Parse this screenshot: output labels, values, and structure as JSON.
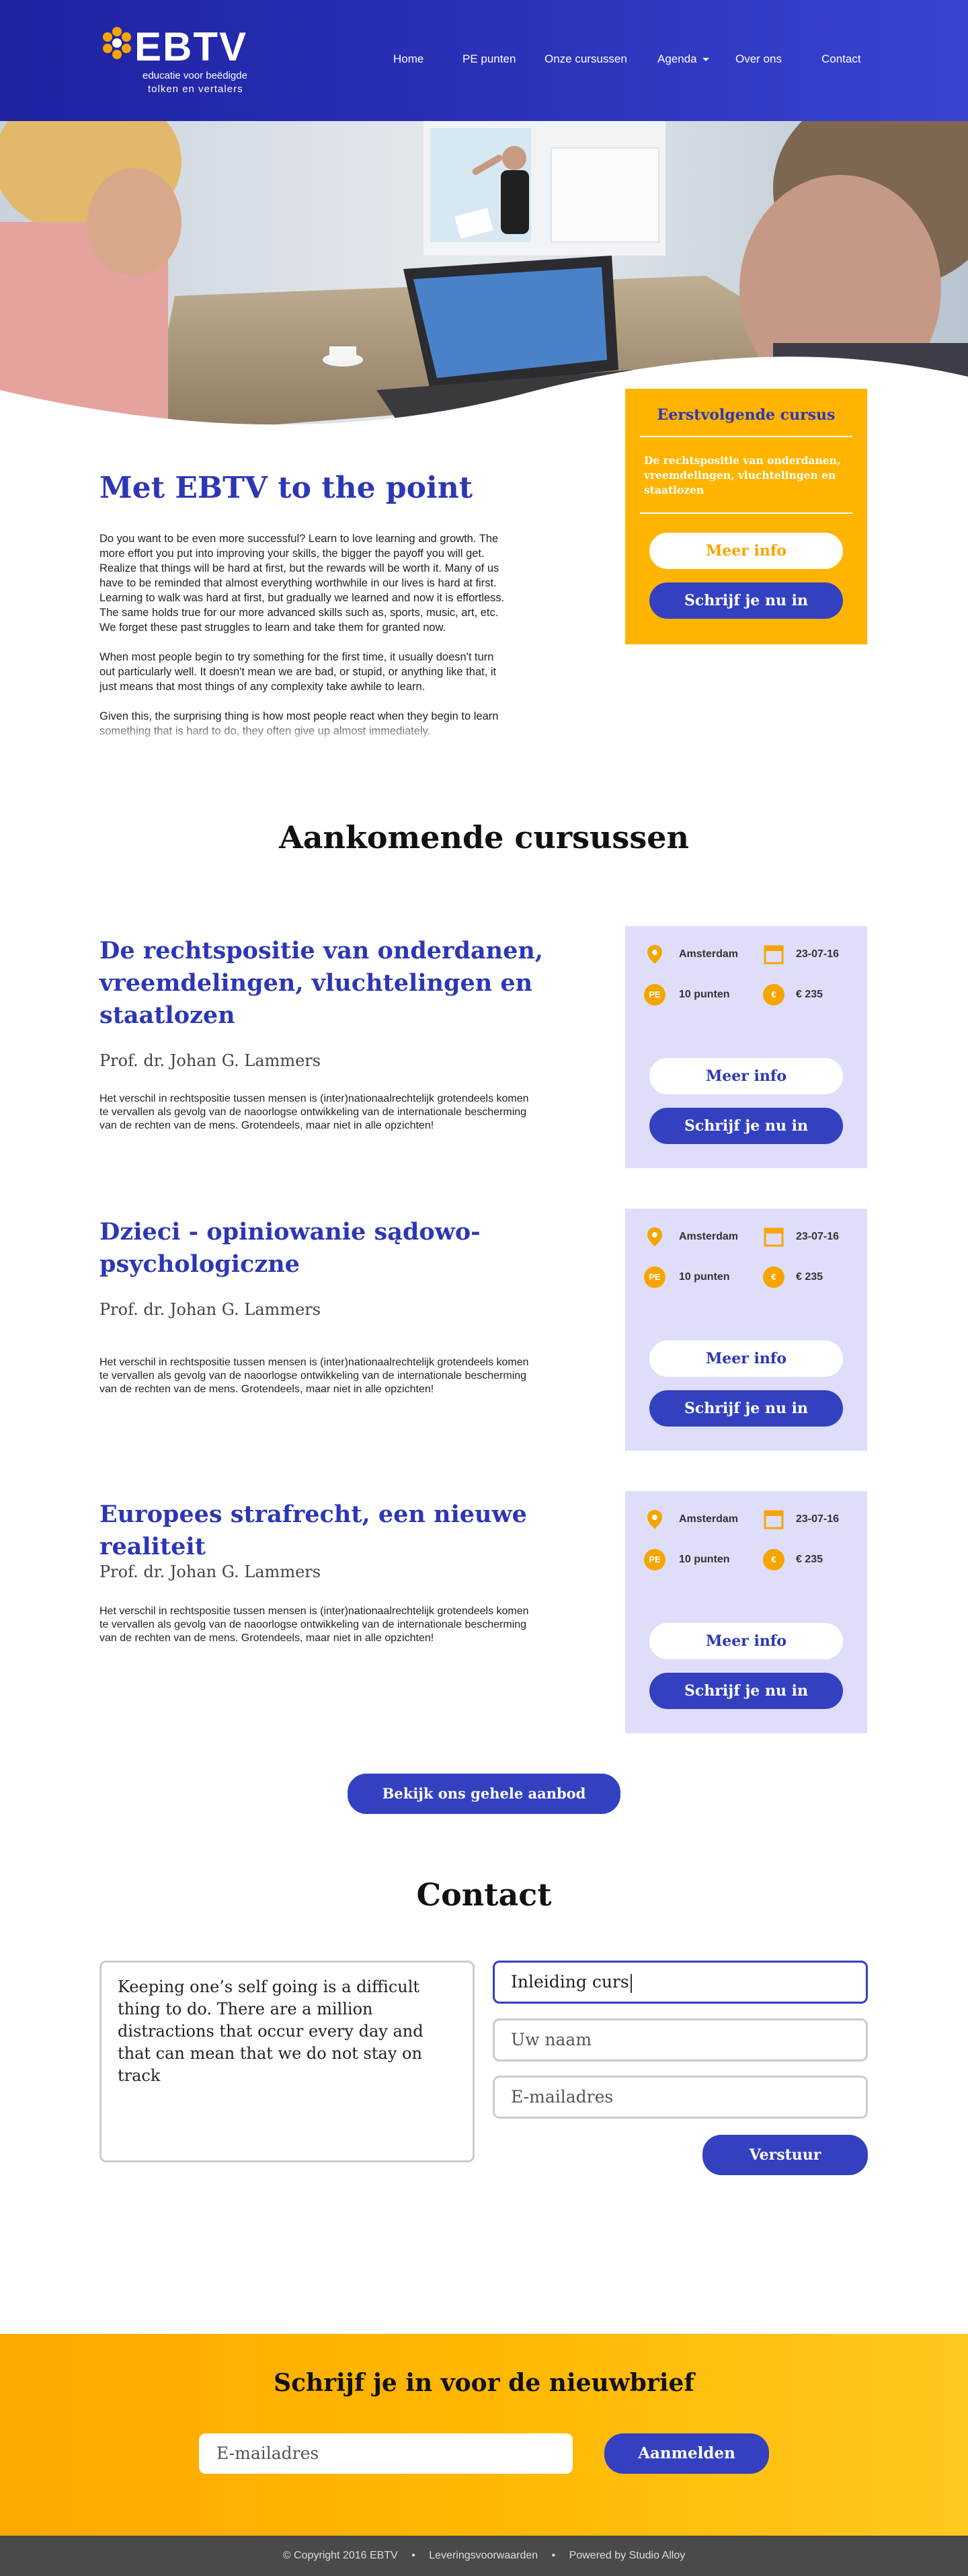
{
  "brand": {
    "name": "EBTV",
    "tagline_line1": "educatie voor beëdigde",
    "tagline_line2": "tolken en vertalers"
  },
  "nav": {
    "items": [
      "Home",
      "PE punten",
      "Onze cursussen",
      "Agenda",
      "Over ons",
      "Contact"
    ]
  },
  "intro": {
    "title": "Met EBTV to the point",
    "paragraphs": [
      "Do you want to be even more successful? Learn to love learning and growth. The more effort you put into improving your skills, the bigger the payoff you will get. Realize that things will be hard at first, but the rewards will be worth it. Many of us have to be reminded that almost everything worthwhile in our lives is hard at first. Learning to walk was hard at first, but gradually we learned and now it is effortless. The same holds true for our more advanced skills such as, sports, music, art, etc. We forget these past struggles to learn and take them for granted now.",
      "When most people begin to try something for the first time, it usually doesn't turn out particularly well. It doesn't mean we are bad, or stupid, or anything like that, it just means that most things of any complexity take awhile to learn.",
      "Given this, the surprising thing is how most people react when they begin to learn something that is hard to do, they often give up almost immediately."
    ]
  },
  "next_course": {
    "heading": "Eerstvolgende cursus",
    "title": "De rechtspositie van onderdanen, vreemdelingen, vluchtelingen en staatlozen",
    "info_label": "Meer info",
    "signup_label": "Schrijf je nu in"
  },
  "upcoming": {
    "title": "Aankomende cursussen",
    "courses": [
      {
        "title": "De rechtspositie van onderdanen, vreemdelingen, vluchtelingen en staatlozen",
        "teacher": "Prof. dr. Johan G. Lammers",
        "description": "Het verschil in rechtspositie tussen mensen is (inter)nationaalrechtelijk grotendeels komen te vervallen als gevolg van de naoorlogse ontwikkeling van de internationale bescherming van de rechten van de mens. Grotendeels, maar niet in alle opzichten!",
        "location": "Amsterdam",
        "date": "23-07-16",
        "points": "10 punten",
        "price": "€ 235",
        "info_label": "Meer info",
        "signup_label": "Schrijf je nu in"
      },
      {
        "title": "Dzieci - opiniowanie sądowo-psychologiczne",
        "teacher": "Prof. dr. Johan G. Lammers",
        "description": "Het verschil in rechtspositie tussen mensen is (inter)nationaalrechtelijk grotendeels komen te vervallen als gevolg van de naoorlogse ontwikkeling van de internationale bescherming van de rechten van de mens. Grotendeels, maar niet in alle opzichten!",
        "location": "Amsterdam",
        "date": "23-07-16",
        "points": "10 punten",
        "price": "€ 235",
        "info_label": "Meer info",
        "signup_label": "Schrijf je nu in"
      },
      {
        "title": "Europees strafrecht, een nieuwe realiteit",
        "teacher": "Prof. dr. Johan G. Lammers",
        "description": "Het verschil in rechtspositie tussen mensen is (inter)nationaalrechtelijk grotendeels komen te vervallen als gevolg van de naoorlogse ontwikkeling van de internationale bescherming van de rechten van de mens. Grotendeels, maar niet in alle opzichten!",
        "location": "Amsterdam",
        "date": "23-07-16",
        "points": "10 punten",
        "price": "€ 235",
        "info_label": "Meer info",
        "signup_label": "Schrijf je nu in"
      }
    ],
    "pe_badge": "PE",
    "euro_badge": "€",
    "all_label": "Bekijk ons gehele aanbod"
  },
  "contact": {
    "title": "Contact",
    "message_value": "Keeping one’s self going is a difficult thing to do. There are a million distractions that occur every day and that can mean that we do not stay on track",
    "course_value": "Inleiding curs",
    "name_placeholder": "Uw naam",
    "email_placeholder": "E-mailadres",
    "submit_label": "Verstuur"
  },
  "newsletter": {
    "title": "Schrijf je in voor de nieuwbrief",
    "email_placeholder": "E-mailadres",
    "submit_label": "Aanmelden"
  },
  "footer": {
    "copyright": "© Copyright  2016  EBTV",
    "terms": "Leveringsvoorwaarden",
    "powered": "Powered by Studio Alloy",
    "separator": "•"
  },
  "colors": {
    "primary_blue": "#3340c0",
    "header_blue": "#2a31b8",
    "accent_orange": "#ffb400",
    "card_lavender": "#dedefb"
  }
}
